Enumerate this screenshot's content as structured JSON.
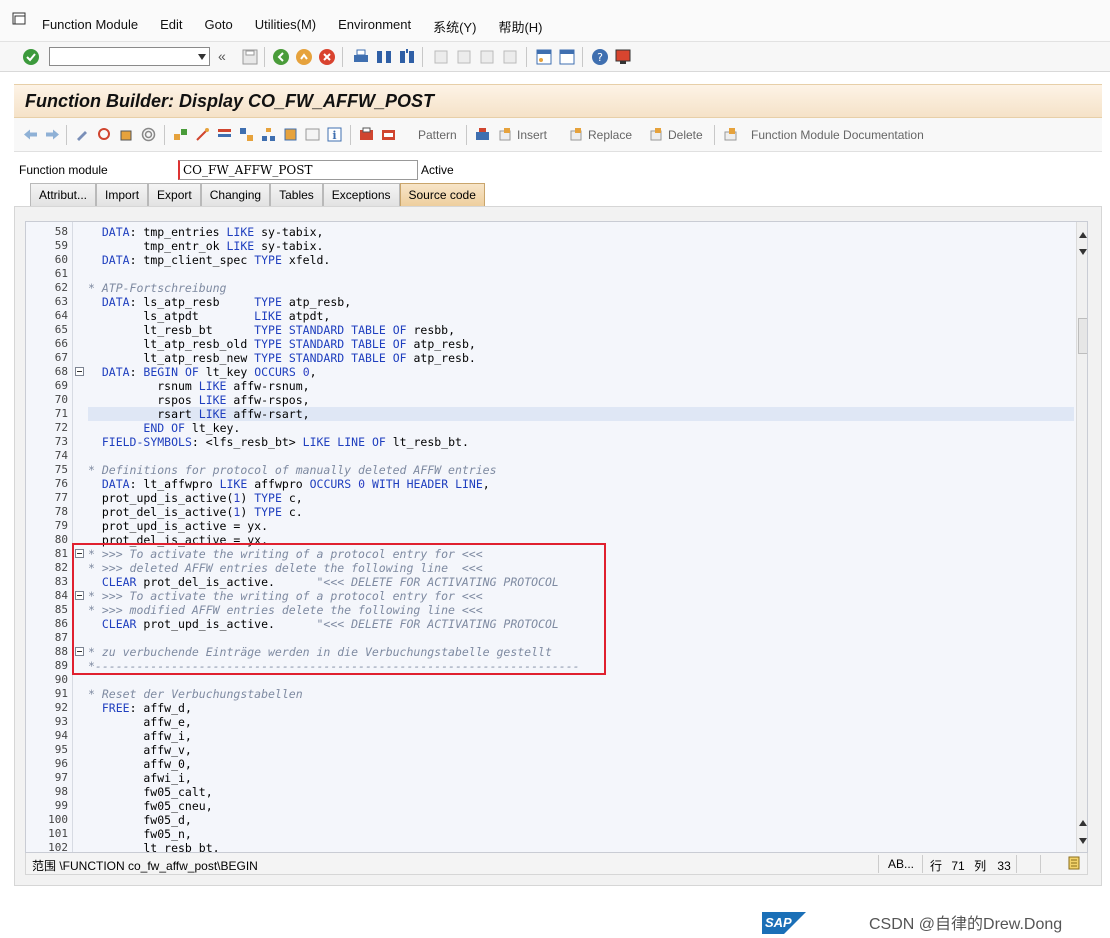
{
  "menubar": {
    "items": [
      {
        "label": "Function Module"
      },
      {
        "label": "Edit"
      },
      {
        "label": "Goto"
      },
      {
        "label": "Utilities(M)"
      },
      {
        "label": "Environment"
      },
      {
        "label": "系统(Y)"
      },
      {
        "label": "帮助(H)"
      }
    ]
  },
  "title": "Function Builder: Display CO_FW_AFFW_POST",
  "apptoolbar": {
    "pattern": "Pattern",
    "insert": "Insert",
    "replace": "Replace",
    "delete": "Delete",
    "documentation": "Function Module Documentation"
  },
  "function_module": {
    "label": "Function module",
    "value": "CO_FW_AFFW_POST",
    "status": "Active"
  },
  "tabs": [
    {
      "label": "Attribut..."
    },
    {
      "label": "Import"
    },
    {
      "label": "Export"
    },
    {
      "label": "Changing"
    },
    {
      "label": "Tables"
    },
    {
      "label": "Exceptions"
    },
    {
      "label": "Source code"
    }
  ],
  "code_lines": [
    {
      "n": "58",
      "t": "  DATA: tmp_entries LIKE sy-tabix,"
    },
    {
      "n": "59",
      "t": "        tmp_entr_ok LIKE sy-tabix."
    },
    {
      "n": "60",
      "t": "  DATA: tmp_client_spec TYPE xfeld."
    },
    {
      "n": "61",
      "t": ""
    },
    {
      "n": "62",
      "t": "* ATP-Fortschreibung"
    },
    {
      "n": "63",
      "t": "  DATA: ls_atp_resb     TYPE atp_resb,"
    },
    {
      "n": "64",
      "t": "        ls_atpdt        LIKE atpdt,"
    },
    {
      "n": "65",
      "t": "        lt_resb_bt      TYPE STANDARD TABLE OF resbb,"
    },
    {
      "n": "66",
      "t": "        lt_atp_resb_old TYPE STANDARD TABLE OF atp_resb,"
    },
    {
      "n": "67",
      "t": "        lt_atp_resb_new TYPE STANDARD TABLE OF atp_resb."
    },
    {
      "n": "68",
      "t": "  DATA: BEGIN OF lt_key OCCURS 0,"
    },
    {
      "n": "69",
      "t": "          rsnum LIKE affw-rsnum,"
    },
    {
      "n": "70",
      "t": "          rspos LIKE affw-rspos,"
    },
    {
      "n": "71",
      "t": "          rsart LIKE affw-rsart,"
    },
    {
      "n": "72",
      "t": "        END OF lt_key."
    },
    {
      "n": "73",
      "t": "  FIELD-SYMBOLS: <lfs_resb_bt> LIKE LINE OF lt_resb_bt."
    },
    {
      "n": "74",
      "t": ""
    },
    {
      "n": "75",
      "t": "* Definitions for protocol of manually deleted AFFW entries"
    },
    {
      "n": "76",
      "t": "  DATA: lt_affwpro LIKE affwpro OCCURS 0 WITH HEADER LINE,"
    },
    {
      "n": "77",
      "t": "  prot_upd_is_active(1) TYPE c,"
    },
    {
      "n": "78",
      "t": "  prot_del_is_active(1) TYPE c."
    },
    {
      "n": "79",
      "t": "  prot_upd_is_active = yx."
    },
    {
      "n": "80",
      "t": "  prot_del_is_active = yx."
    },
    {
      "n": "81",
      "t": "* >>> To activate the writing of a protocol entry for <<<"
    },
    {
      "n": "82",
      "t": "* >>> deleted AFFW entries delete the following line  <<<"
    },
    {
      "n": "83",
      "t": "  CLEAR prot_del_is_active.      \"<<< DELETE FOR ACTIVATING PROTOCOL"
    },
    {
      "n": "84",
      "t": "* >>> To activate the writing of a protocol entry for <<<"
    },
    {
      "n": "85",
      "t": "* >>> modified AFFW entries delete the following line <<<"
    },
    {
      "n": "86",
      "t": "  CLEAR prot_upd_is_active.      \"<<< DELETE FOR ACTIVATING PROTOCOL"
    },
    {
      "n": "87",
      "t": ""
    },
    {
      "n": "88",
      "t": "* zu verbuchende Einträge werden in die Verbuchungstabelle gestellt"
    },
    {
      "n": "89",
      "t": "*----------------------------------------------------------------------"
    },
    {
      "n": "90",
      "t": ""
    },
    {
      "n": "91",
      "t": "* Reset der Verbuchungstabellen"
    },
    {
      "n": "92",
      "t": "  FREE: affw_d,"
    },
    {
      "n": "93",
      "t": "        affw_e,"
    },
    {
      "n": "94",
      "t": "        affw_i,"
    },
    {
      "n": "95",
      "t": "        affw_v,"
    },
    {
      "n": "96",
      "t": "        affw_0,"
    },
    {
      "n": "97",
      "t": "        afwi_i,"
    },
    {
      "n": "98",
      "t": "        fw05_calt,"
    },
    {
      "n": "99",
      "t": "        fw05_cneu,"
    },
    {
      "n": "100",
      "t": "        fw05_d,"
    },
    {
      "n": "101",
      "t": "        fw05_n,"
    },
    {
      "n": "102",
      "t": "        lt_resb_bt,"
    }
  ],
  "status": {
    "scope": "范围 \\FUNCTION co_fw_affw_post\\BEGIN",
    "mode": "AB...",
    "row_label": "行",
    "row": "71",
    "col_label": "列",
    "col": "33"
  },
  "footer": {
    "sap": "SAP",
    "watermark": "CSDN @自律的Drew.Dong"
  }
}
